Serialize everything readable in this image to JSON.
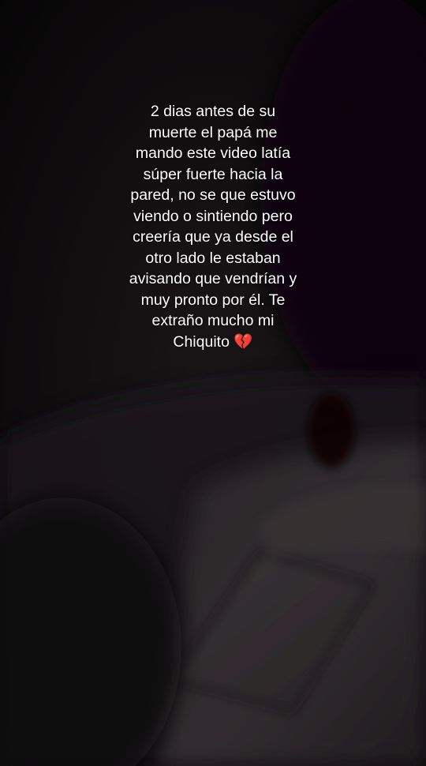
{
  "story": {
    "caption": "2 dias antes de su\nmuerte el papá me\nmando este video latía\nsúper fuerte hacia la\npared, no se que estuvo\nviendo o sintiendo pero\ncreería que ya desde el\notro lado le estaban\navisando que vendrían y\nmuy pronto por él. Te\nextraño mucho mi\nChiquito 💔"
  },
  "colors": {
    "background": "#0d0b0d",
    "text": "#ffffff",
    "emoji_accent": "#d6283a"
  }
}
